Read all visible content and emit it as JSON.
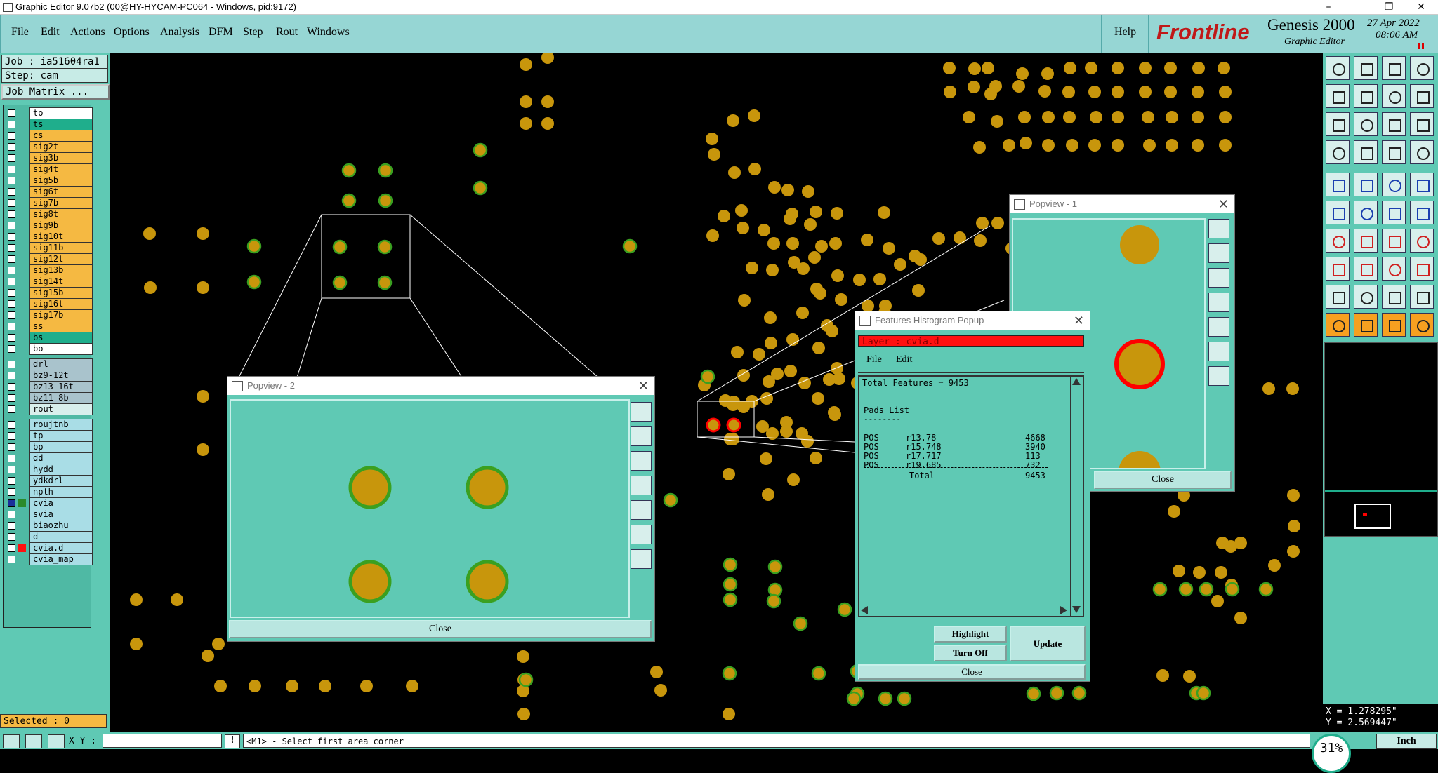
{
  "window": {
    "title": "Graphic Editor 9.07b2 (00@HY-HYCAM-PC064 - Windows, pid:9172)"
  },
  "menubar": {
    "items": [
      "File",
      "Edit",
      "Actions",
      "Options",
      "Analysis",
      "DFM",
      "Step",
      "Rout",
      "Windows"
    ],
    "help": "Help"
  },
  "brand": {
    "logo": "Frontline",
    "product": "Genesis 2000",
    "subtitle": "Graphic Editor",
    "date": "27 Apr 2022",
    "time": "08:06 AM"
  },
  "job": {
    "job": "Job : ia51604ra1",
    "step": "Step: cam",
    "matrix_button": "Job Matrix ..."
  },
  "layers": [
    {
      "name": "to",
      "color": "#ffffff"
    },
    {
      "name": "ts",
      "color": "#1fae8c"
    },
    {
      "name": "cs",
      "color": "#f5b942"
    },
    {
      "name": "sig2t",
      "color": "#f5b942"
    },
    {
      "name": "sig3b",
      "color": "#f5b942"
    },
    {
      "name": "sig4t",
      "color": "#f5b942"
    },
    {
      "name": "sig5b",
      "color": "#f5b942"
    },
    {
      "name": "sig6t",
      "color": "#f5b942"
    },
    {
      "name": "sig7b",
      "color": "#f5b942"
    },
    {
      "name": "sig8t",
      "color": "#f5b942"
    },
    {
      "name": "sig9b",
      "color": "#f5b942"
    },
    {
      "name": "sig10t",
      "color": "#f5b942"
    },
    {
      "name": "sig11b",
      "color": "#f5b942"
    },
    {
      "name": "sig12t",
      "color": "#f5b942"
    },
    {
      "name": "sig13b",
      "color": "#f5b942"
    },
    {
      "name": "sig14t",
      "color": "#f5b942"
    },
    {
      "name": "sig15b",
      "color": "#f5b942"
    },
    {
      "name": "sig16t",
      "color": "#f5b942"
    },
    {
      "name": "sig17b",
      "color": "#f5b942"
    },
    {
      "name": "ss",
      "color": "#f5b942"
    },
    {
      "name": "bs",
      "color": "#1fae8c"
    },
    {
      "name": "bo",
      "color": "#ffffff"
    },
    {
      "name": "drl",
      "color": "#a9c3cc"
    },
    {
      "name": "bz9-12t",
      "color": "#a9c3cc"
    },
    {
      "name": "bz13-16t",
      "color": "#a9c3cc"
    },
    {
      "name": "bz11-8b",
      "color": "#a9c3cc"
    },
    {
      "name": "rout",
      "color": "#d8efec"
    },
    {
      "name": "roujtnb",
      "color": "#a9dde6"
    },
    {
      "name": "tp",
      "color": "#a9dde6"
    },
    {
      "name": "bp",
      "color": "#a9dde6"
    },
    {
      "name": "dd",
      "color": "#a9dde6"
    },
    {
      "name": "hydd",
      "color": "#a9dde6"
    },
    {
      "name": "ydkdrl",
      "color": "#a9dde6"
    },
    {
      "name": "npth",
      "color": "#a9dde6"
    },
    {
      "name": "cvia",
      "color": "#a9dde6"
    },
    {
      "name": "svia",
      "color": "#a9dde6"
    },
    {
      "name": "biaozhu",
      "color": "#a9dde6"
    },
    {
      "name": "d",
      "color": "#a9dde6"
    },
    {
      "name": "cvia.d",
      "color": "#a9dde6"
    },
    {
      "name": "cvia_map",
      "color": "#a9dde6"
    }
  ],
  "status": {
    "selected": "Selected : 0",
    "xy_label": "X Y :",
    "prompt": "<M1> - Select first area corner",
    "zoom": "31%",
    "units": "Inch"
  },
  "coords": {
    "x": "X = 1.278295\"",
    "y": "Y = 2.569447\""
  },
  "popview1": {
    "title": "Popview - 1",
    "close": "Close"
  },
  "popview2": {
    "title": "Popview - 2",
    "close": "Close"
  },
  "histogram": {
    "title": "Features Histogram Popup",
    "layer": "Layer :  cvia.d",
    "menu": [
      "File",
      "Edit"
    ],
    "total_line": "Total Features = 9453",
    "pads_header": "Pads List",
    "rows": [
      {
        "type": "POS",
        "sym": "r13.78",
        "count": "4668"
      },
      {
        "type": "POS",
        "sym": "r15.748",
        "count": "3940"
      },
      {
        "type": "POS",
        "sym": "r17.717",
        "count": "113"
      },
      {
        "type": "POS",
        "sym": "r19.685",
        "count": "732"
      }
    ],
    "total_label": "Total",
    "total_value": "9453",
    "buttons": {
      "highlight": "Highlight",
      "turn_off": "Turn Off",
      "update": "Update",
      "close": "Close"
    }
  },
  "colors": {
    "pad": "#c8960c",
    "pad_ring": "#3aa020",
    "select": "#ff0000"
  }
}
